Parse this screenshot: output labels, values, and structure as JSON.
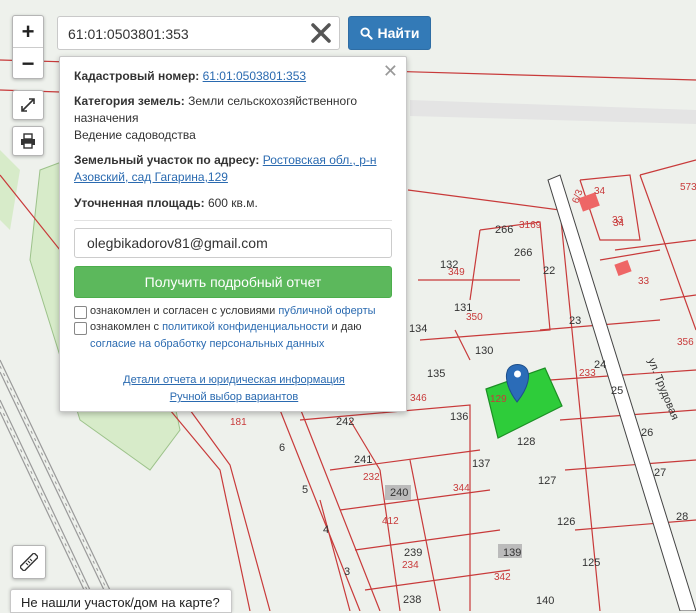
{
  "search": {
    "value": "61:01:0503801:353",
    "button_label": "Найти"
  },
  "popup": {
    "cadastral_label": "Кадастровый номер:",
    "cadastral_value": "61:01:0503801:353",
    "category_label": "Категория земель:",
    "category_value_1": "Земли сельскохозяйственного",
    "category_value_2": "назначения",
    "usage": "Ведение садоводства",
    "address_label": "Земельный участок по адресу:",
    "address_value_1": "Ростовская обл., р-н",
    "address_value_2": "Азовский, сад Гагарина,129",
    "area_label": "Уточненная площадь:",
    "area_value": "600 кв.м.",
    "email_value": "olegbikadorov81@gmail.com",
    "report_button": "Получить подробный отчет",
    "check1_text": "ознакомлен и согласен с условиями",
    "check1_link": "публичной оферты",
    "check2_text": "ознакомлен с",
    "check2_link": "политикой конфиденциальности",
    "check2_text2": "и даю",
    "check2_link2": "согласие на обработку персональных данных",
    "details_link": "Детали отчета и юридическая информация",
    "manual_link": "Ручной выбор вариантов"
  },
  "controls": {
    "zoom_in": "+",
    "zoom_out": "−"
  },
  "not_found": "Не нашли участок/дом на карте?",
  "map": {
    "street_label": "ул. Трудовая",
    "parcel_labels": [
      "34",
      "34",
      "573",
      "6/3",
      "33",
      "33",
      "356",
      "24",
      "25",
      "26",
      "27",
      "28",
      "22",
      "23",
      "233",
      "266",
      "3169",
      "266",
      "132",
      "349",
      "131",
      "350",
      "134",
      "130",
      "135",
      "129",
      "128",
      "127",
      "126",
      "125",
      "136",
      "137",
      "344",
      "242",
      "241",
      "232",
      "240",
      "412",
      "239",
      "234",
      "238",
      "139",
      "342",
      "140",
      "346",
      "181",
      "6",
      "5",
      "4",
      "3"
    ]
  },
  "colors": {
    "parcel_stroke": "#c83a3a",
    "selected_fill": "#2ecc3a",
    "pin": "#2b6cb8",
    "find_button": "#337ab7",
    "report_button": "#5cb85c"
  }
}
